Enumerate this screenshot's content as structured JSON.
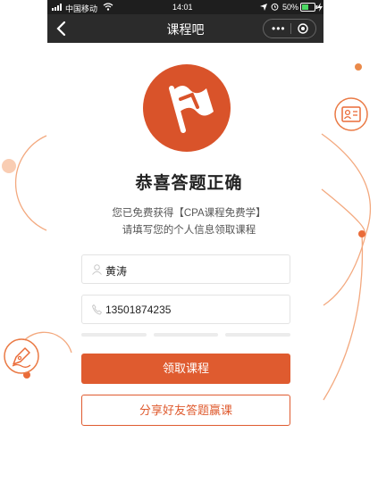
{
  "status_bar": {
    "carrier": "中国移动",
    "time": "14:01",
    "battery": "50%"
  },
  "nav": {
    "title": "课程吧"
  },
  "main": {
    "heading": "恭喜答题正确",
    "line1": "您已免费获得【CPA课程免费学】",
    "line2": "请填写您的个人信息领取课程"
  },
  "form": {
    "name_value": "黄涛",
    "phone_value": "13501874235"
  },
  "buttons": {
    "claim_label": "领取课程",
    "share_label": "分享好友答题赢课"
  },
  "colors": {
    "accent": "#df5b2f",
    "nav_bg": "#2b2b2b",
    "status_bg": "#1e1e1e"
  },
  "icons": [
    "signal-icon",
    "wifi-icon",
    "location-icon",
    "alarm-icon",
    "battery-icon",
    "charging-icon",
    "back-icon",
    "more-icon",
    "target-icon",
    "flag-icon",
    "id-card-icon",
    "pen-icon",
    "user-icon",
    "phone-icon"
  ]
}
